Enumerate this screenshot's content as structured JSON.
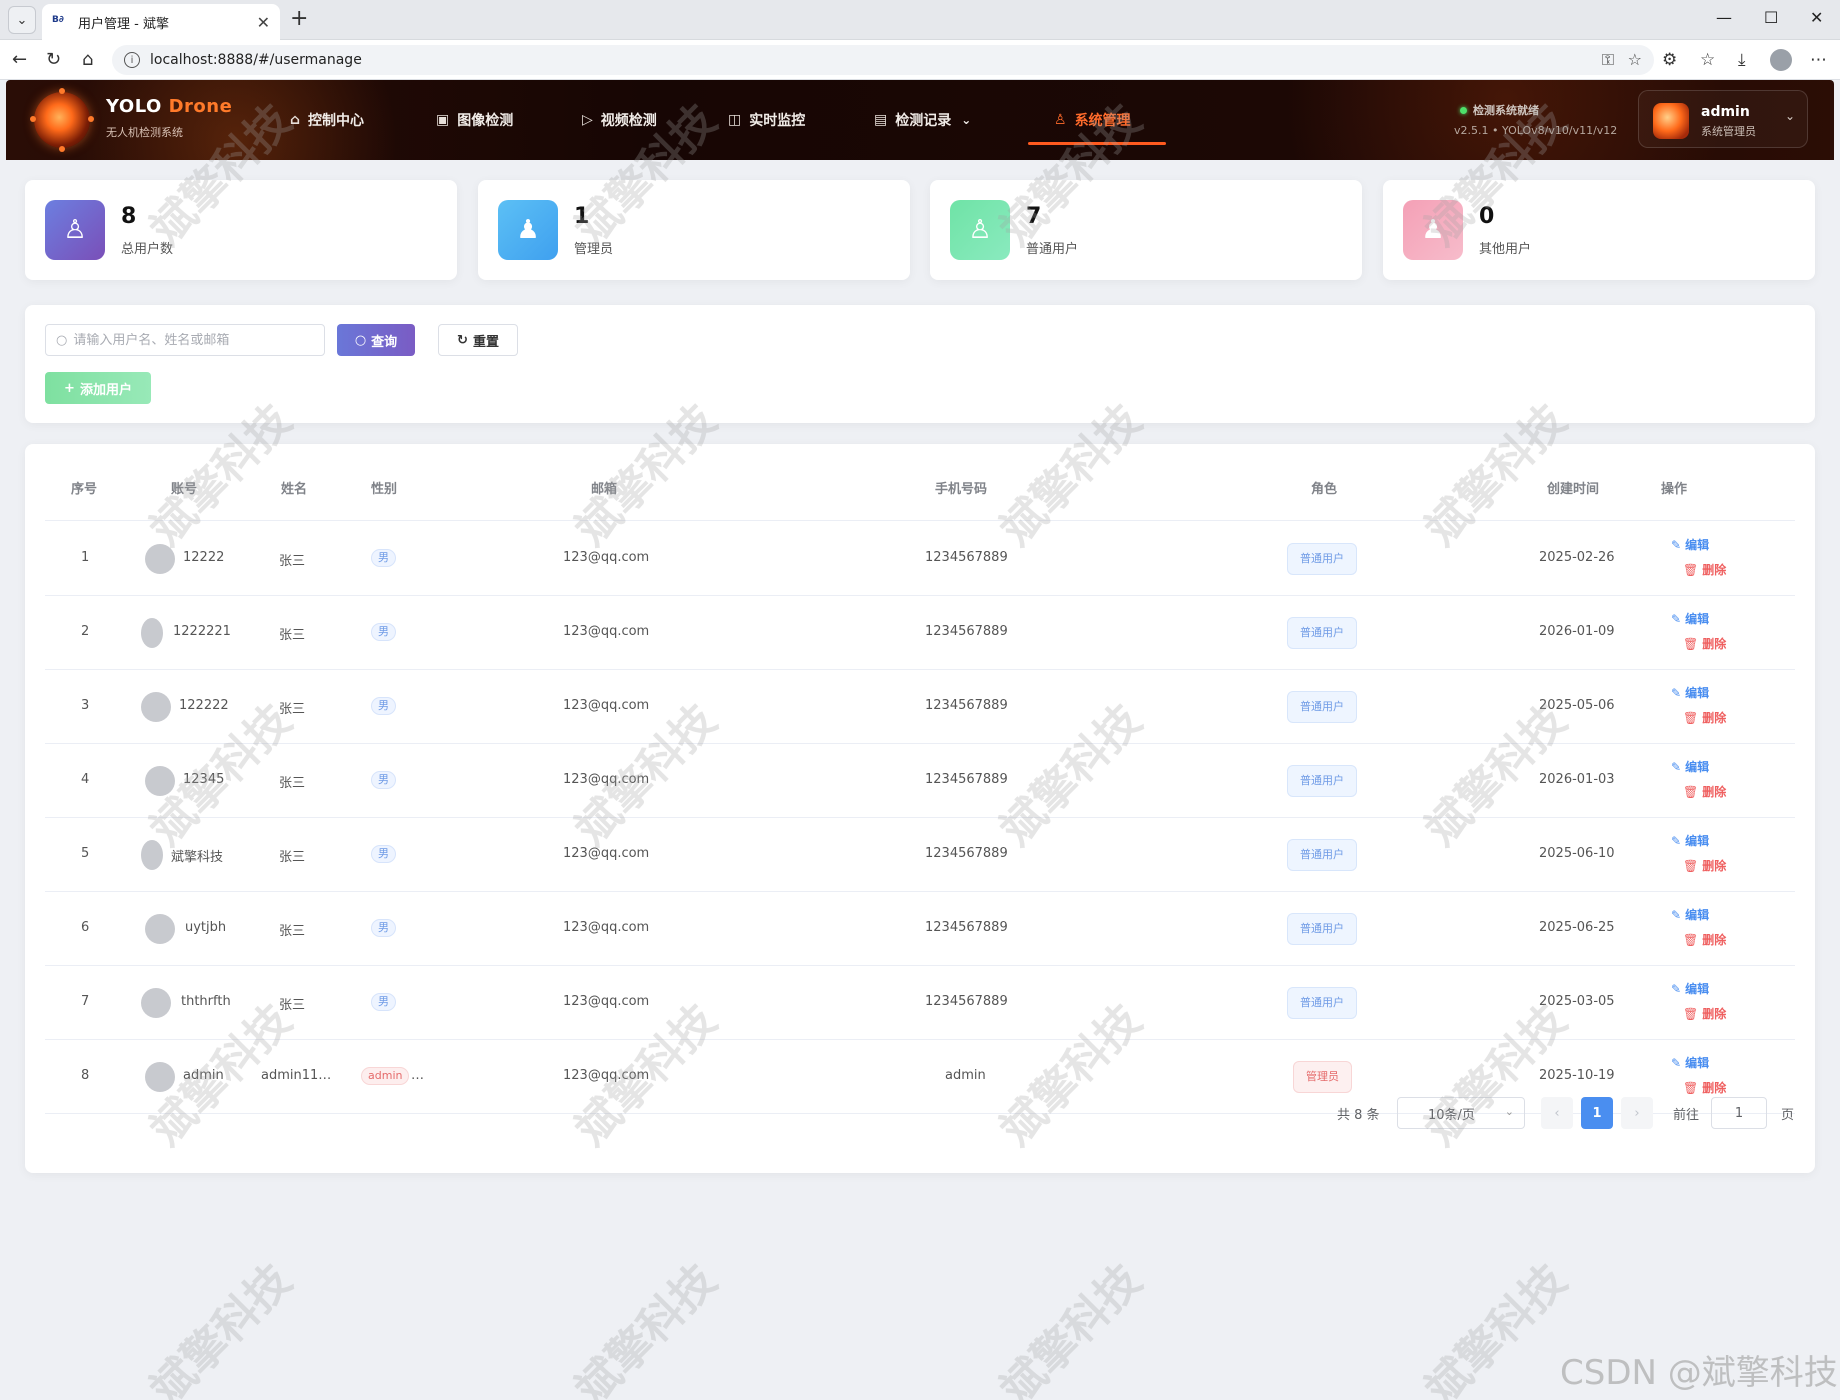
{
  "browser": {
    "tab_title": "用户管理 - 斌擎",
    "url": "localhost:8888/#/usermanage"
  },
  "header": {
    "brand_main": "YOLO",
    "brand_accent": "Drone",
    "brand_sub": "无人机检测系统",
    "nav": [
      {
        "label": "控制中心",
        "icon": "home-icon"
      },
      {
        "label": "图像检测",
        "icon": "image-icon"
      },
      {
        "label": "视频检测",
        "icon": "play-circle-icon"
      },
      {
        "label": "实时监控",
        "icon": "camera-icon"
      },
      {
        "label": "检测记录",
        "icon": "document-icon"
      },
      {
        "label": "系统管理",
        "icon": "user-icon"
      }
    ],
    "status_text": "检测系统就绪",
    "version_text": "v2.5.1 • YOLOv8/v10/v11/v12",
    "user_name": "admin",
    "user_role": "系统管理员",
    "accent_color": "#ff6b2b"
  },
  "stats": [
    {
      "value": "8",
      "label": "总用户数"
    },
    {
      "value": "1",
      "label": "管理员"
    },
    {
      "value": "7",
      "label": "普通用户"
    },
    {
      "value": "0",
      "label": "其他用户"
    }
  ],
  "filter": {
    "search_placeholder": "请输入用户名、姓名或邮箱",
    "query_label": "查询",
    "reset_label": "重置",
    "add_label": "添加用户"
  },
  "table": {
    "headers": [
      "序号",
      "账号",
      "姓名",
      "性别",
      "邮箱",
      "手机号码",
      "角色",
      "创建时间",
      "操作"
    ],
    "edit_label": "编辑",
    "delete_label": "删除",
    "rows": [
      {
        "no": "1",
        "account": "12222",
        "name": "张三",
        "gender": "男",
        "email": "123@qq.com",
        "phone": "1234567889",
        "role": "普通用户",
        "created": "2025-02-26"
      },
      {
        "no": "2",
        "account": "1222221",
        "name": "张三",
        "gender": "男",
        "email": "123@qq.com",
        "phone": "1234567889",
        "role": "普通用户",
        "created": "2026-01-09"
      },
      {
        "no": "3",
        "account": "122222",
        "name": "张三",
        "gender": "男",
        "email": "123@qq.com",
        "phone": "1234567889",
        "role": "普通用户",
        "created": "2025-05-06"
      },
      {
        "no": "4",
        "account": "12345",
        "name": "张三",
        "gender": "男",
        "email": "123@qq.com",
        "phone": "1234567889",
        "role": "普通用户",
        "created": "2026-01-03"
      },
      {
        "no": "5",
        "account": "斌擎科技",
        "name": "张三",
        "gender": "男",
        "email": "123@qq.com",
        "phone": "1234567889",
        "role": "普通用户",
        "created": "2025-06-10"
      },
      {
        "no": "6",
        "account": "uytjbh",
        "name": "张三",
        "gender": "男",
        "email": "123@qq.com",
        "phone": "1234567889",
        "role": "普通用户",
        "created": "2025-06-25"
      },
      {
        "no": "7",
        "account": "ththrfth",
        "name": "张三",
        "gender": "男",
        "email": "123@qq.com",
        "phone": "1234567889",
        "role": "普通用户",
        "created": "2025-03-05"
      },
      {
        "no": "8",
        "account": "admin",
        "name": "admin11…",
        "gender": "admin",
        "gender_suffix": "…",
        "email": "123@qq.com",
        "phone": "admin",
        "role": "管理员",
        "created": "2025-10-19"
      }
    ]
  },
  "pagination": {
    "total_text": "共 8 条",
    "page_size": "10条/页",
    "current_page": "1",
    "goto_label": "前往",
    "goto_value": "1",
    "unit_label": "页"
  },
  "watermark": "斌擎科技",
  "csdn_mark": "CSDN @斌擎科技"
}
